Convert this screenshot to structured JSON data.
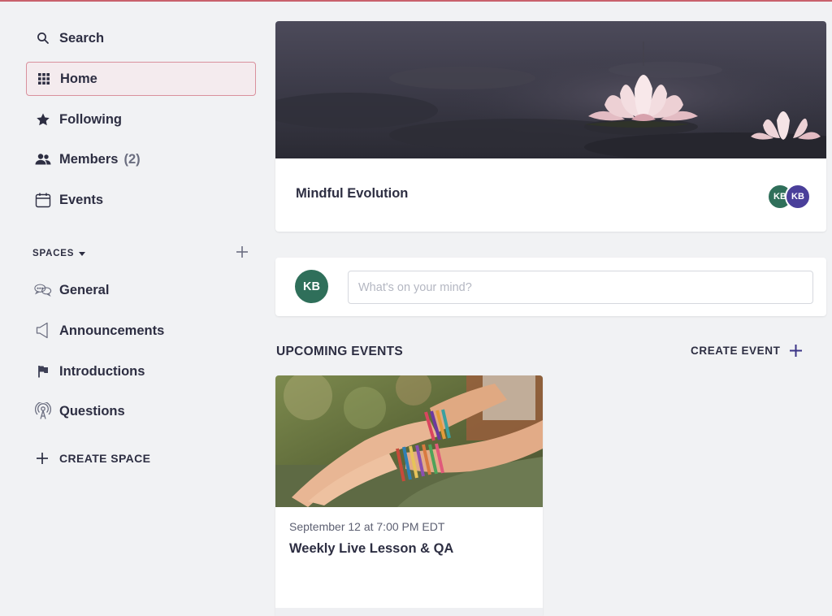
{
  "colors": {
    "accent": "#c9616c",
    "active_bg": "#f4ebee",
    "text": "#2d2e42",
    "avatar_green": "#2f6f5a",
    "avatar_purple": "#4a3f9a"
  },
  "sidebar": {
    "search": {
      "label": "Search",
      "icon": "search-icon"
    },
    "items": [
      {
        "label": "Home",
        "icon": "grid-icon",
        "active": true
      },
      {
        "label": "Following",
        "icon": "star-icon"
      },
      {
        "label": "Members",
        "icon": "people-icon",
        "count": "(2)"
      },
      {
        "label": "Events",
        "icon": "calendar-icon"
      }
    ],
    "spaces_label": "SPACES",
    "spaces": [
      {
        "label": "General",
        "icon": "chat-bubbles-icon"
      },
      {
        "label": "Announcements",
        "icon": "megaphone-icon"
      },
      {
        "label": "Introductions",
        "icon": "flag-icon"
      },
      {
        "label": "Questions",
        "icon": "broadcast-icon"
      }
    ],
    "create_space": "CREATE SPACE"
  },
  "hero": {
    "title": "Mindful Evolution",
    "members": [
      "KB",
      "KB"
    ]
  },
  "composer": {
    "avatar": "KB",
    "placeholder": "What's on your mind?"
  },
  "events": {
    "title": "UPCOMING EVENTS",
    "create_label": "CREATE EVENT",
    "items": [
      {
        "date": "September 12 at 7:00 PM EDT",
        "name": "Weekly Live Lesson & QA"
      }
    ]
  }
}
